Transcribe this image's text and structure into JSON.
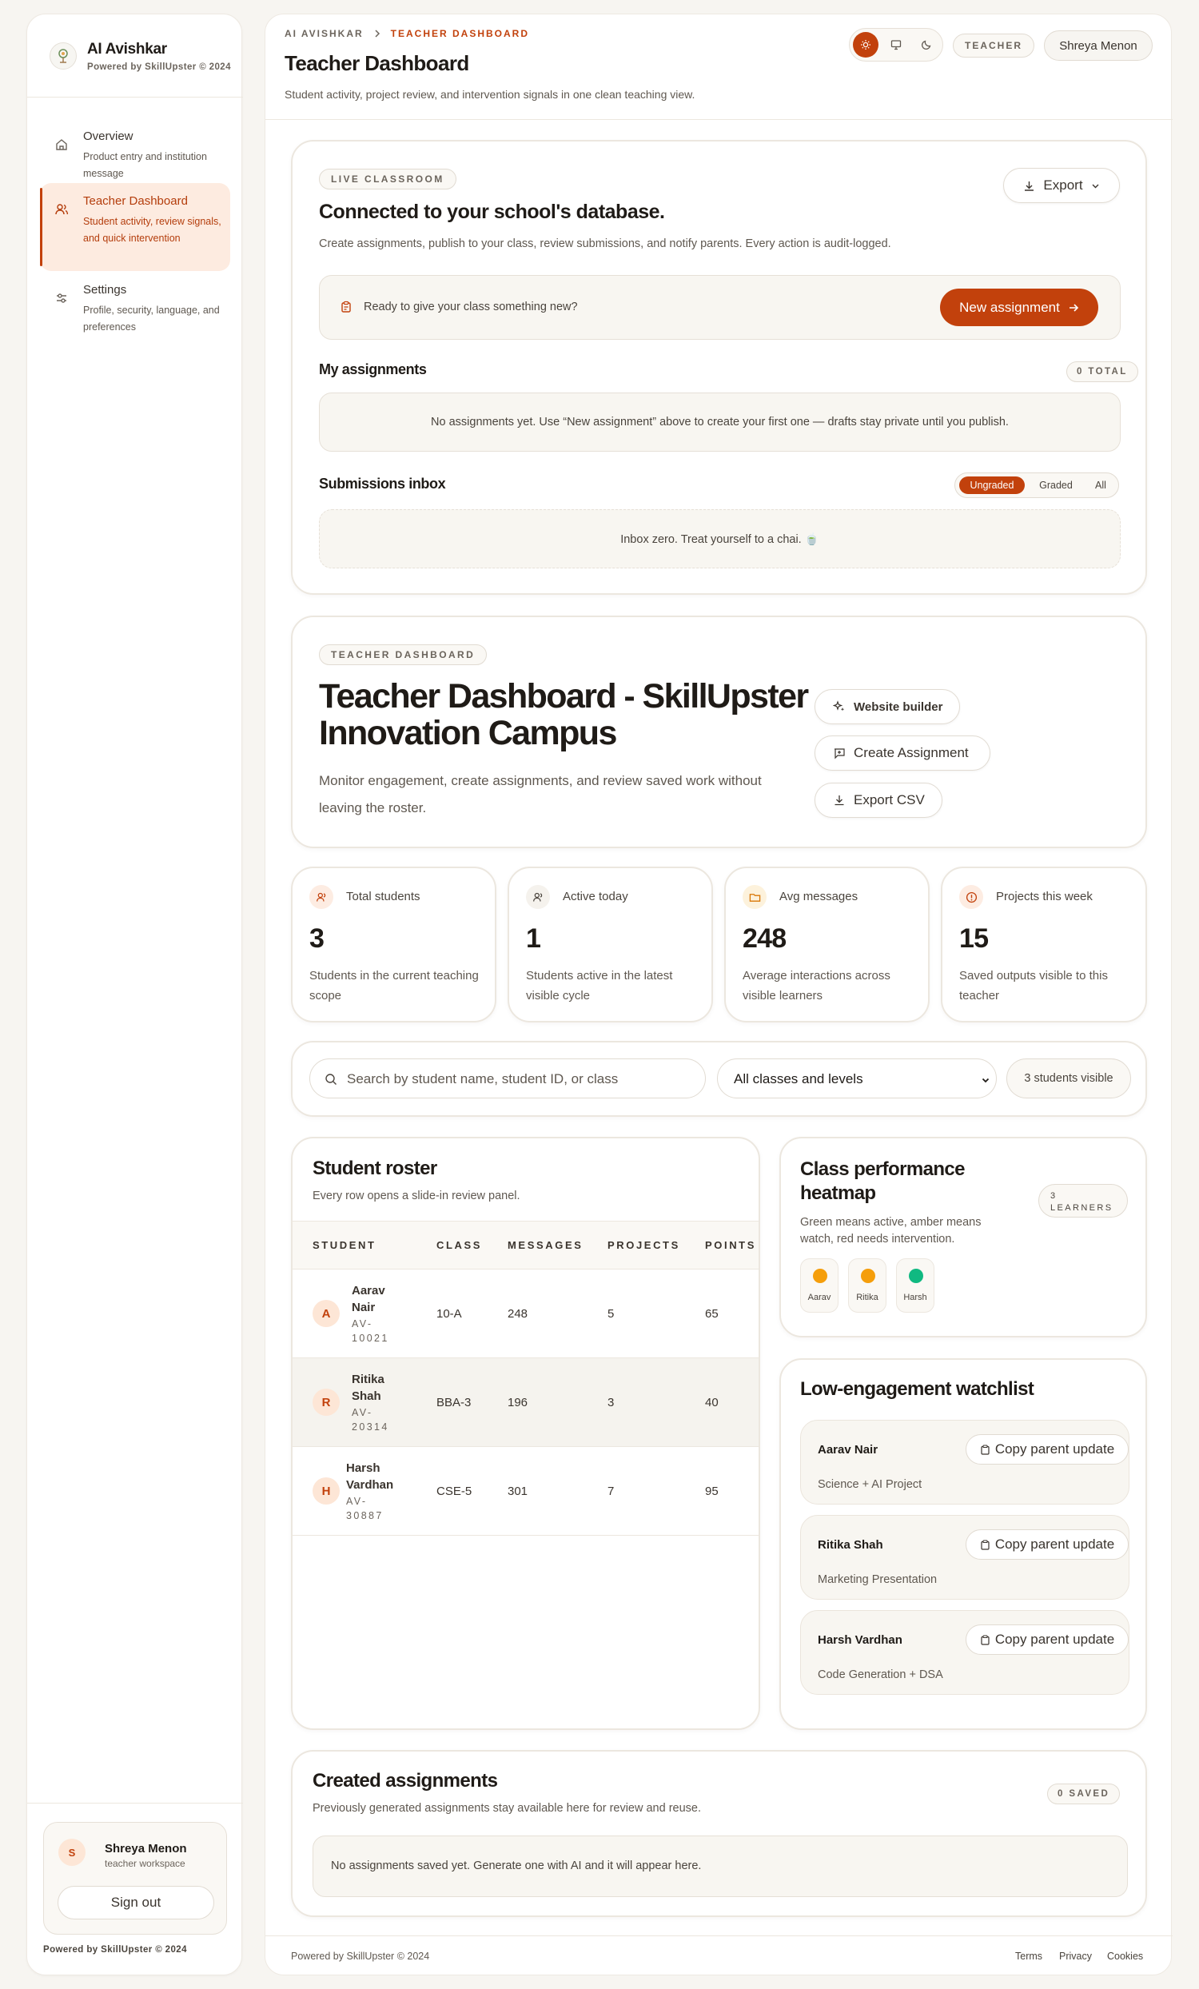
{
  "brand": {
    "title": "AI Avishkar",
    "subtitle": "Powered by SkillUpster © 2024"
  },
  "sidebar": {
    "items": [
      {
        "label": "Overview",
        "desc": "Product entry and institution message",
        "icon": "home-icon"
      },
      {
        "label": "Teacher Dashboard",
        "desc": "Student activity, review signals, and quick intervention",
        "icon": "users-icon"
      },
      {
        "label": "Settings",
        "desc": "Profile, security, language, and preferences",
        "icon": "sliders-icon"
      }
    ],
    "user": {
      "initial": "S",
      "name": "Shreya Menon",
      "role": "teacher workspace",
      "signout": "Sign out"
    },
    "footer": "Powered by SkillUpster © 2024"
  },
  "header": {
    "crumb_root": "AI AVISHKAR",
    "crumb_current": "TEACHER DASHBOARD",
    "title": "Teacher Dashboard",
    "subtitle": "Student activity, project review, and intervention signals in one clean teaching view.",
    "role": "TEACHER",
    "user": "Shreya Menon"
  },
  "live": {
    "tag": "LIVE CLASSROOM",
    "title": "Connected to your school's database.",
    "desc": "Create assignments, publish to your class, review submissions, and notify parents. Every action is audit-logged.",
    "export": "Export",
    "prompt": "Ready to give your class something new?",
    "new_assignment": "New assignment",
    "my_assignments": "My assignments",
    "total_badge": "0 TOTAL",
    "empty_assignments": "No assignments yet. Use “New assignment” above to create your first one — drafts stay private until you publish.",
    "inbox_title": "Submissions inbox",
    "filters": [
      "Ungraded",
      "Graded",
      "All"
    ],
    "inbox_empty": "Inbox zero. Treat yourself to a chai. 🍵"
  },
  "hero": {
    "tag": "TEACHER DASHBOARD",
    "title_line1": "Teacher Dashboard - SkillUpster",
    "title_line2": "Innovation Campus",
    "desc": "Monitor engagement, create assignments, and review saved work without leaving the roster.",
    "website_builder": "Website builder",
    "create_assignment": "Create Assignment",
    "export_csv": "Export CSV"
  },
  "stats": [
    {
      "label": "Total students",
      "value": "3",
      "desc": "Students in the current teaching scope"
    },
    {
      "label": "Active today",
      "value": "1",
      "desc": "Students active in the latest visible cycle"
    },
    {
      "label": "Avg messages",
      "value": "248",
      "desc": "Average interactions across visible learners"
    },
    {
      "label": "Projects this week",
      "value": "15",
      "desc": "Saved outputs visible to this teacher"
    }
  ],
  "filter": {
    "search_placeholder": "Search by student name, student ID, or class",
    "class_select": "All classes and levels",
    "visible": "3 students visible"
  },
  "roster": {
    "title": "Student roster",
    "subtitle": "Every row opens a slide-in review panel.",
    "columns": [
      "STUDENT",
      "CLASS",
      "MESSAGES",
      "PROJECTS",
      "POINTS"
    ],
    "rows": [
      {
        "initial": "A",
        "name": "Aarav Nair",
        "id": "AV-10021",
        "class": "10-A",
        "messages": "248",
        "projects": "5",
        "points": "65"
      },
      {
        "initial": "R",
        "name": "Ritika Shah",
        "id": "AV-20314",
        "class": "BBA-3",
        "messages": "196",
        "projects": "3",
        "points": "40"
      },
      {
        "initial": "H",
        "name": "Harsh Vardhan",
        "id": "AV-30887",
        "class": "CSE-5",
        "messages": "301",
        "projects": "7",
        "points": "95"
      }
    ]
  },
  "heatmap": {
    "title": "Class performance heatmap",
    "badge_line1": "3",
    "badge_line2": "LEARNERS",
    "desc": "Green means active, amber means watch, red needs intervention.",
    "cells": [
      {
        "name": "Aarav",
        "color": "#f59e0b"
      },
      {
        "name": "Ritika",
        "color": "#f59e0b"
      },
      {
        "name": "Harsh",
        "color": "#10b981"
      }
    ]
  },
  "watchlist": {
    "title": "Low-engagement watchlist",
    "items": [
      {
        "name": "Aarav Nair",
        "project": "Science + AI Project",
        "action": "Copy parent update"
      },
      {
        "name": "Ritika Shah",
        "project": "Marketing Presentation",
        "action": "Copy parent update"
      },
      {
        "name": "Harsh Vardhan",
        "project": "Code Generation + DSA",
        "action": "Copy parent update"
      }
    ]
  },
  "created": {
    "title": "Created assignments",
    "subtitle": "Previously generated assignments stay available here for review and reuse.",
    "badge": "0 SAVED",
    "empty": "No assignments saved yet. Generate one with AI and it will appear here."
  },
  "footer": {
    "text": "Powered by SkillUpster © 2024",
    "links": [
      "Terms",
      "Privacy",
      "Cookies"
    ]
  },
  "colors": {
    "accent": "#c2410c",
    "amber": "#f59e0b",
    "green": "#10b981"
  }
}
